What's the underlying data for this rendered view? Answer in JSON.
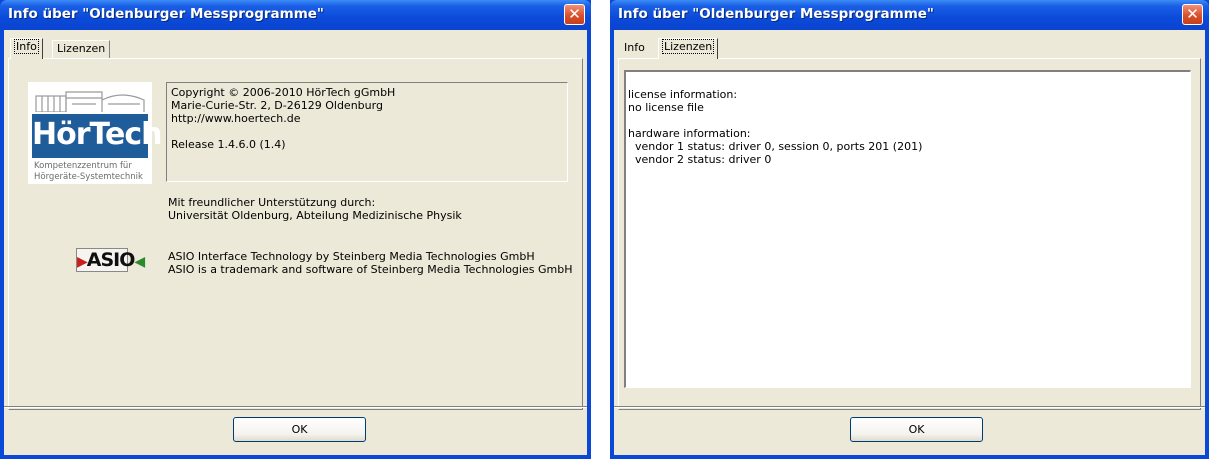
{
  "left_window": {
    "title": "Info über \"Oldenburger Messprogramme\"",
    "close_glyph": "✕",
    "tabs": [
      {
        "label": "Info",
        "active": true
      },
      {
        "label": "Lizenzen",
        "active": false
      }
    ],
    "logo": {
      "name": "HörTech",
      "tagline_1": "Kompetenzzentrum für",
      "tagline_2": "Hörgeräte-Systemtechnik"
    },
    "info_lines": {
      "copyright": "Copyright © 2006-2010 HörTech gGmbH",
      "address": "Marie-Curie-Str. 2, D-26129 Oldenburg",
      "website": "http://www.hoertech.de",
      "release": "Release 1.4.6.0 (1.4)"
    },
    "support": {
      "line_1": "Mit freundlicher Unterstützung durch:",
      "line_2": "Universität Oldenburg, Abteilung Medizinische Physik"
    },
    "asio": {
      "logo_text": "ASIO",
      "line_1": "ASIO Interface Technology by Steinberg Media Technologies GmbH",
      "line_2": "ASIO is a trademark and software of Steinberg Media Technologies GmbH"
    },
    "ok_label": "OK"
  },
  "right_window": {
    "title": "Info über \"Oldenburger Messprogramme\"",
    "close_glyph": "✕",
    "tabs": [
      {
        "label": "Info",
        "active": false
      },
      {
        "label": "Lizenzen",
        "active": true
      }
    ],
    "license_text": {
      "l1": "license information:",
      "l2": "no license file",
      "l3": "hardware information:",
      "l4": "  vendor 1 status: driver 0, session 0, ports 201 (201)",
      "l5": "  vendor 2 status: driver 0"
    },
    "ok_label": "OK"
  },
  "colors": {
    "titlebar": "#0b4ad9",
    "client": "#ece9d8",
    "close": "#d9512b",
    "logo_blue": "#1f5c9a"
  }
}
